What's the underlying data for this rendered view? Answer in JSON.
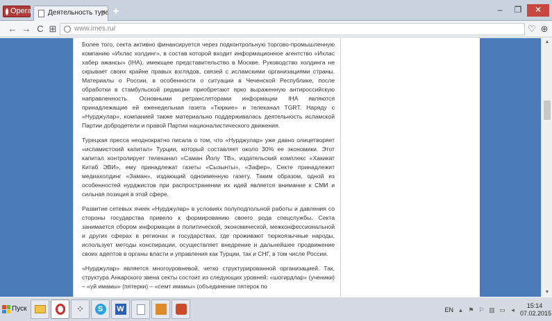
{
  "browser": {
    "app_label": "Opera",
    "tab_title": "Деятельность турецкой ре",
    "new_tab_symbol": "+",
    "address": "www.imes.ru/"
  },
  "article": {
    "paragraphs": [
      "Более того, секта активно финансируется через подконтрольную торгово-промышленную компанию «Ихлас холдинг», в состав которой входит информационное агентство «Ихлас хабер ажансы» (IHA), имеющее представительство в Москве. Руководство холдинга не скрывает своих крайне правых взглядов, связей с исламскими организациями страны. Материалы о России, в особенности о ситуации в Чеченской Республике, после обработки в стамбульской редакции приобретают ярко выраженную антироссийскую направленность. Основными ретрансляторами информации IHA являются принадлежащие ей еженедельная газета «Тюркие» и телеканал TGRT. Наряду с «Нурджулар», компанией также материально поддерживалась деятельность исламской Партии добродетели и правой Партии националистического движения.",
      "Турецкая пресса неоднократно писала о том, что «Нурджулар» уже давно олицетворяет «исламистский капитал» Турции, который составляет около 30% ее экономики. Этот капитал контролирует телеканал «Саман Йолу ТВ», издательский комплекс «Хакикат Китаб ЭВИ», ему принадлежат газеты «Сызынты», «Зафер». Секте принадлежит медиахолдинг «Заман», издающий одноименную газету. Таким образом, одной из особенностей нурджистов при распространении их идей является внимание к СМИ и сильная позиция в этой сфере.",
      "Развитие сетевых ячеек «Нурджулар» в условиях полуподпольной работы и давления со стороны государства привело к формированию своего рода спецслужбы. Секта занимается сбором информации в политической, экономической, межконфессиональной и других сферах в регионах и государствах, где проживают тюркоязычные народы, использует методы конспирации, осуществляет внедрение и дальнейшее продвижение своих адептов в органы власти и управления как Турции, так и СНГ, в том числе России.",
      "«Нурджулар» является многоуровневой, четко структурированной организацией. Так, структура Анкарского звена секты состоит из следующих уровней: «шогирдлар» (ученики) – «уй имамы» (пятерки) – «семт имамы» (объединение пятерок по"
    ]
  },
  "taskbar": {
    "start_label": "Пуск",
    "language": "EN",
    "time": "15:14",
    "date": "07.02.2015"
  }
}
